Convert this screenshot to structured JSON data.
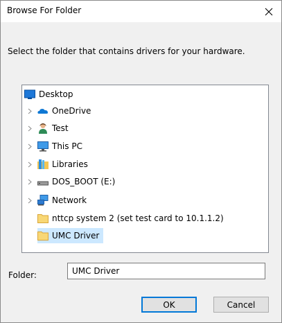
{
  "window": {
    "title": "Browse For Folder"
  },
  "instruction": "Select the folder that contains drivers for your hardware.",
  "tree": {
    "items": [
      {
        "label": "Desktop",
        "icon": "desktop-icon",
        "expandable": false,
        "selected": false
      },
      {
        "label": "OneDrive",
        "icon": "onedrive-icon",
        "expandable": true,
        "selected": false
      },
      {
        "label": "Test",
        "icon": "user-icon",
        "expandable": true,
        "selected": false
      },
      {
        "label": "This PC",
        "icon": "computer-icon",
        "expandable": true,
        "selected": false
      },
      {
        "label": "Libraries",
        "icon": "libraries-icon",
        "expandable": true,
        "selected": false
      },
      {
        "label": "DOS_BOOT (E:)",
        "icon": "drive-icon",
        "expandable": true,
        "selected": false
      },
      {
        "label": "Network",
        "icon": "network-icon",
        "expandable": true,
        "selected": false
      },
      {
        "label": "nttcp system 2 (set test card to 10.1.1.2)",
        "icon": "folder-icon",
        "expandable": false,
        "selected": false
      },
      {
        "label": "UMC Driver",
        "icon": "folder-icon",
        "expandable": false,
        "selected": true
      }
    ]
  },
  "folder": {
    "label": "Folder:",
    "value": "UMC Driver"
  },
  "buttons": {
    "ok": "OK",
    "cancel": "Cancel"
  },
  "colors": {
    "selection": "#cce8ff",
    "accent": "#0078d7"
  }
}
